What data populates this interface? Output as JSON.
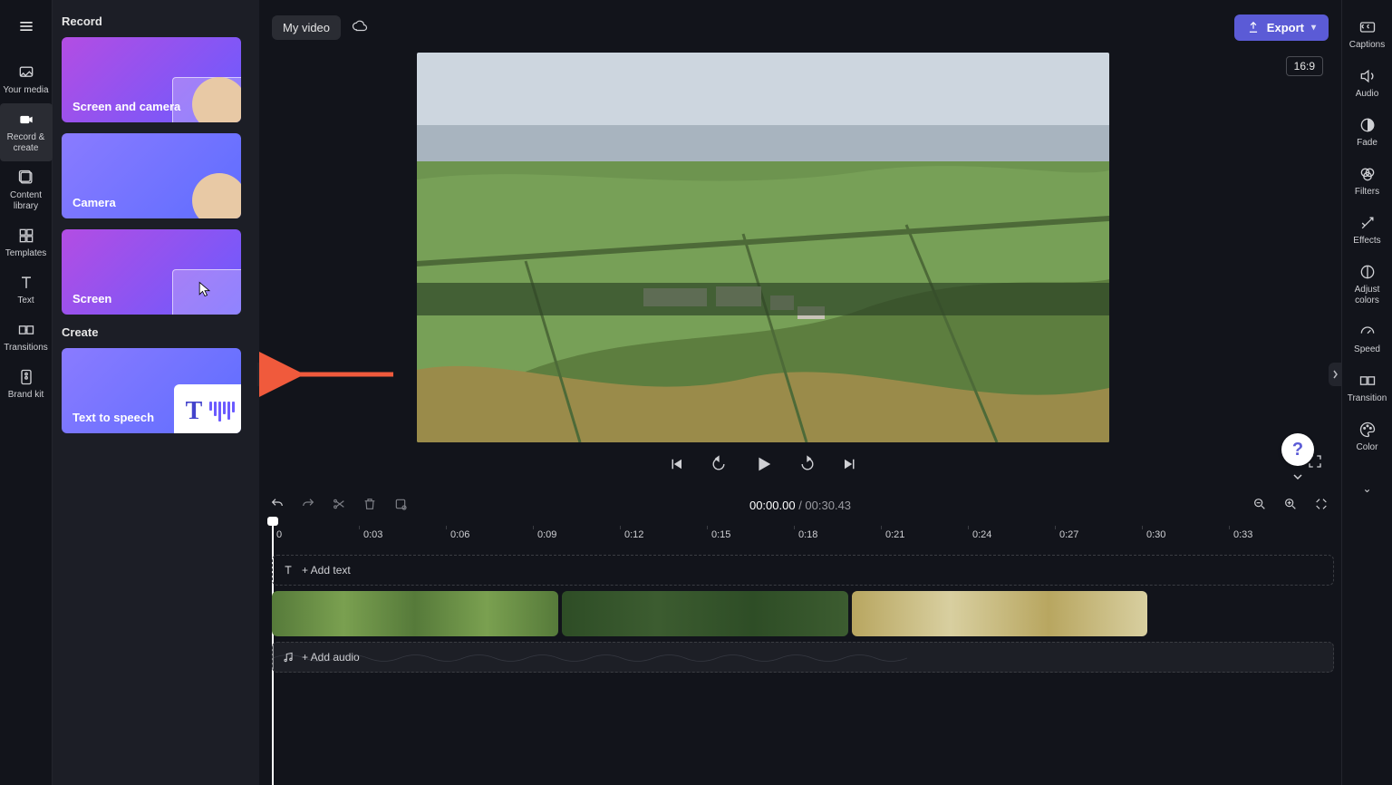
{
  "leftnav": {
    "items": [
      {
        "label": "Your media"
      },
      {
        "label": "Record &\ncreate"
      },
      {
        "label": "Content\nlibrary"
      },
      {
        "label": "Templates"
      },
      {
        "label": "Text"
      },
      {
        "label": "Transitions"
      },
      {
        "label": "Brand kit"
      }
    ]
  },
  "panel": {
    "section1": "Record",
    "cards_record": [
      {
        "label": "Screen and camera"
      },
      {
        "label": "Camera"
      },
      {
        "label": "Screen"
      }
    ],
    "section2": "Create",
    "cards_create": [
      {
        "label": "Text to speech"
      }
    ]
  },
  "topbar": {
    "title": "My video",
    "export": "Export"
  },
  "aspect": "16:9",
  "timeline": {
    "current": "00:00.00",
    "sep": " / ",
    "duration": "00:30.43",
    "ticks": [
      "0",
      "0:03",
      "0:06",
      "0:09",
      "0:12",
      "0:15",
      "0:18",
      "0:21",
      "0:24",
      "0:27",
      "0:30",
      "0:33"
    ],
    "add_text": "+ Add text",
    "add_audio": "+ Add audio"
  },
  "rightnav": {
    "items": [
      {
        "label": "Captions"
      },
      {
        "label": "Audio"
      },
      {
        "label": "Fade"
      },
      {
        "label": "Filters"
      },
      {
        "label": "Effects"
      },
      {
        "label": "Adjust\ncolors"
      },
      {
        "label": "Speed"
      },
      {
        "label": "Transition"
      },
      {
        "label": "Color"
      }
    ]
  },
  "help": "?"
}
